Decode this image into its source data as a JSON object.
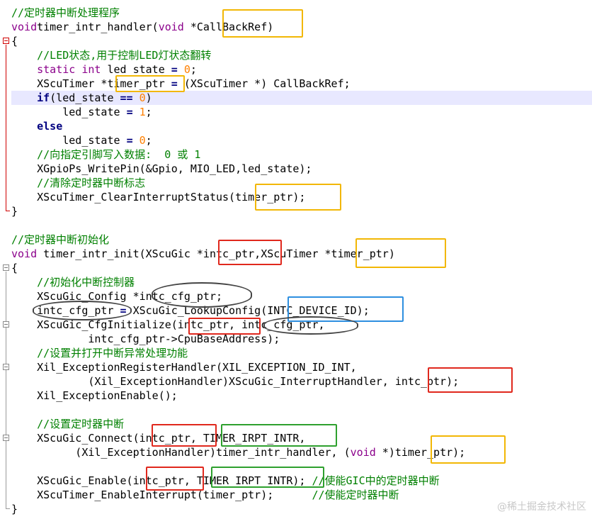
{
  "editor": {
    "lines": [
      [
        [
          "cm",
          "//定时器中断处理程序"
        ]
      ],
      [
        [
          "kw",
          "void"
        ],
        [
          "",
          "timer_intr_handler("
        ],
        [
          "kw",
          "void"
        ],
        [
          "",
          " *CallBackRef)"
        ]
      ],
      [
        [
          "",
          "{"
        ]
      ],
      [
        [
          "cm",
          "    //LED状态,用于控制LED灯状态翻转"
        ]
      ],
      [
        [
          "",
          "    "
        ],
        [
          "kw",
          "static int"
        ],
        [
          "",
          " led_state "
        ],
        [
          "op",
          "="
        ],
        [
          "",
          " "
        ],
        [
          "num",
          "0"
        ],
        [
          "",
          ";"
        ]
      ],
      [
        [
          "",
          "    XScuTimer *timer_ptr "
        ],
        [
          "op",
          "="
        ],
        [
          "",
          " (XScuTimer *) CallBackRef;"
        ]
      ],
      [
        [
          "",
          "    "
        ],
        [
          "kwb",
          "if"
        ],
        [
          "",
          "(led_state "
        ],
        [
          "op",
          "=="
        ],
        [
          "",
          " "
        ],
        [
          "num",
          "0"
        ],
        [
          "",
          ")"
        ]
      ],
      [
        [
          "",
          "        led_state "
        ],
        [
          "op",
          "="
        ],
        [
          "",
          " "
        ],
        [
          "num",
          "1"
        ],
        [
          "",
          ";"
        ]
      ],
      [
        [
          "",
          "    "
        ],
        [
          "kwb",
          "else"
        ]
      ],
      [
        [
          "",
          "        led_state "
        ],
        [
          "op",
          "="
        ],
        [
          "",
          " "
        ],
        [
          "num",
          "0"
        ],
        [
          "",
          ";"
        ]
      ],
      [
        [
          "cm",
          "    //向指定引脚写入数据:  0 或 1"
        ]
      ],
      [
        [
          "",
          "    XGpioPs_WritePin(&Gpio, MIO_LED,led_state);"
        ]
      ],
      [
        [
          "cm",
          "    //清除定时器中断标志"
        ]
      ],
      [
        [
          "",
          "    XScuTimer_ClearInterruptStatus(timer_ptr);"
        ]
      ],
      [
        [
          "",
          "}"
        ]
      ],
      [
        [
          "",
          ""
        ]
      ],
      [
        [
          "cm",
          "//定时器中断初始化"
        ]
      ],
      [
        [
          "kw",
          "void"
        ],
        [
          "",
          " timer_intr_init(XScuGic *intc_ptr,XScuTimer *timer_ptr)"
        ]
      ],
      [
        [
          "",
          "{"
        ]
      ],
      [
        [
          "cm",
          "    //初始化中断控制器"
        ]
      ],
      [
        [
          "",
          "    XScuGic_Config *intc_cfg_ptr;"
        ]
      ],
      [
        [
          "",
          "    intc_cfg_ptr "
        ],
        [
          "op",
          "="
        ],
        [
          "",
          " XScuGic_LookupConfig(INTC_DEVICE_ID);"
        ]
      ],
      [
        [
          "",
          "    XScuGic_CfgInitialize(intc_ptr, intc_cfg_ptr,"
        ]
      ],
      [
        [
          "",
          "            intc_cfg_ptr->CpuBaseAddress);"
        ]
      ],
      [
        [
          "cm",
          "    //设置并打开中断异常处理功能"
        ]
      ],
      [
        [
          "",
          "    Xil_ExceptionRegisterHandler(XIL_EXCEPTION_ID_INT,"
        ]
      ],
      [
        [
          "",
          "            (Xil_ExceptionHandler)XScuGic_InterruptHandler, intc_ptr);"
        ]
      ],
      [
        [
          "",
          "    Xil_ExceptionEnable();"
        ]
      ],
      [
        [
          "",
          ""
        ]
      ],
      [
        [
          "cm",
          "    //设置定时器中断"
        ]
      ],
      [
        [
          "",
          "    XScuGic_Connect(intc_ptr, TIMER_IRPT_INTR,"
        ]
      ],
      [
        [
          "",
          "          (Xil_ExceptionHandler)timer_intr_handler, ("
        ],
        [
          "kw",
          "void"
        ],
        [
          "",
          " *)timer_ptr);"
        ]
      ],
      [
        [
          "",
          ""
        ]
      ],
      [
        [
          "",
          "    XScuGic_Enable(intc_ptr, TIMER_IRPT_INTR); "
        ],
        [
          "cm",
          "//使能GIC中的定时器中断"
        ]
      ],
      [
        [
          "",
          "    XScuTimer_EnableInterrupt(timer_ptr);      "
        ],
        [
          "cm",
          "//使能定时器中断"
        ]
      ],
      [
        [
          "",
          "}"
        ]
      ]
    ]
  },
  "watermark": "@稀土掘金技术社区",
  "colors": {
    "comment": "#008000",
    "keyword": "#8b008b",
    "number": "#ff8000",
    "highlight_line": "#e8e8ff",
    "box_yellow": "#f2b705",
    "box_red": "#e0281d",
    "box_blue": "#2e8fe0",
    "box_green": "#2ea02e",
    "box_black": "#444444"
  }
}
